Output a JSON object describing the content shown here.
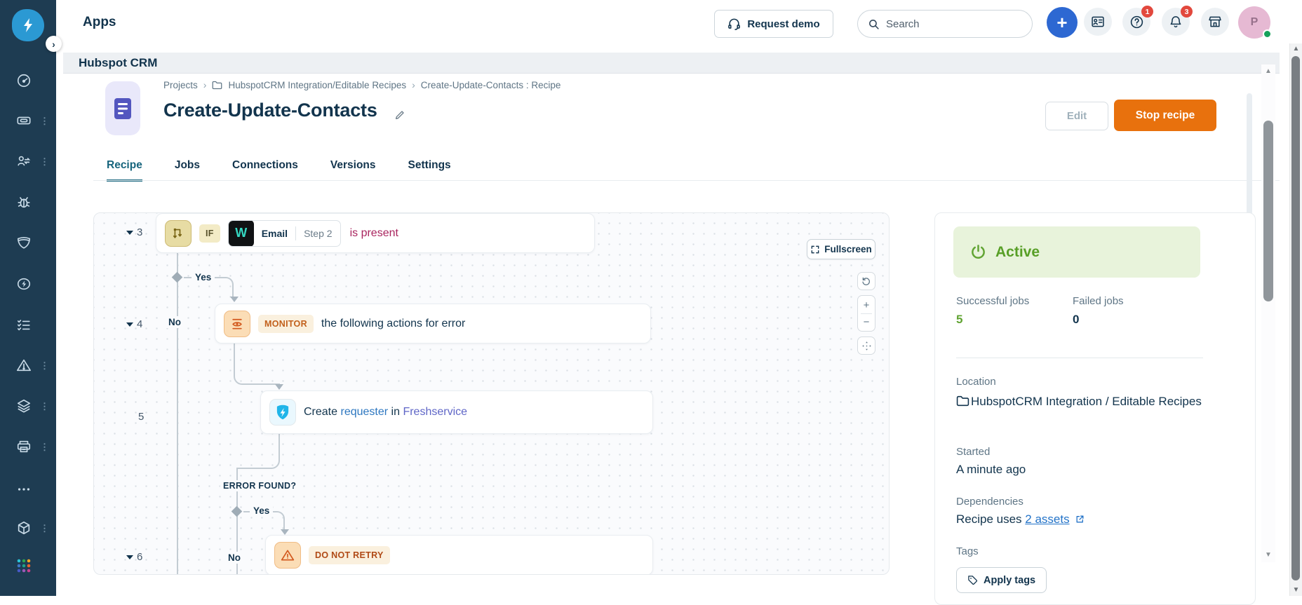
{
  "colors": {
    "sidebar_navy": "#1E3C52",
    "accent_orange": "#E8710D",
    "active_tab_teal": "#17657D",
    "status_green": "#61A433",
    "link_blue": "#2373C8",
    "condition_magenta": "#A9245E",
    "badge_red": "#E2483D"
  },
  "sidebar": {
    "icons": [
      "logo-bolt",
      "dashboard-gauge",
      "ticket",
      "contact-sync",
      "bug",
      "shield",
      "automation-bolt",
      "checklist",
      "alert-triangle",
      "layers",
      "printer",
      "more-ellipsis",
      "package-cube",
      "app-switcher-grid"
    ]
  },
  "topbar": {
    "title": "Apps",
    "request_demo_label": "Request demo",
    "search_placeholder": "Search",
    "help_badge": "1",
    "notifications_badge": "3",
    "avatar_initial": "P"
  },
  "subheader": {
    "app_name": "Hubspot CRM"
  },
  "breadcrumb": {
    "items": [
      {
        "label": "Projects"
      },
      {
        "label": "HubspotCRM Integration/Editable Recipes"
      },
      {
        "label": "Create-Update-Contacts : Recipe"
      }
    ]
  },
  "page": {
    "title": "Create-Update-Contacts",
    "edit_button": "Edit",
    "stop_button": "Stop recipe"
  },
  "tabs": {
    "items": [
      {
        "label": "Recipe"
      },
      {
        "label": "Jobs"
      },
      {
        "label": "Connections"
      },
      {
        "label": "Versions"
      },
      {
        "label": "Settings"
      }
    ]
  },
  "canvas": {
    "fullscreen_label": "Fullscreen",
    "zoom_in_label": "+",
    "zoom_out_label": "−",
    "steps": {
      "s3": {
        "number": "3",
        "chip": "IF",
        "pill_app": "W",
        "pill_field": "Email",
        "pill_step": "Step 2",
        "condition": "is present"
      },
      "s4": {
        "number": "4",
        "chip": "MONITOR",
        "text": "the following actions for error"
      },
      "s5": {
        "number": "5",
        "text_create": "Create",
        "link_object": "requester",
        "text_in": "in",
        "link_app": "Freshservice"
      },
      "s6": {
        "number": "6",
        "chip": "DO NOT RETRY"
      }
    },
    "labels": {
      "yes_top": "Yes",
      "no_top": "No",
      "error_found": "ERROR FOUND?",
      "yes_bottom": "Yes",
      "no_bottom": "No"
    }
  },
  "panel": {
    "status_label": "Active",
    "successful_jobs_label": "Successful jobs",
    "successful_jobs_value": "5",
    "failed_jobs_label": "Failed jobs",
    "failed_jobs_value": "0",
    "location_label": "Location",
    "location_value": "HubspotCRM Integration / Editable Recipes",
    "started_label": "Started",
    "started_value": "A minute ago",
    "dependencies_label": "Dependencies",
    "dependencies_prefix": "Recipe uses ",
    "dependencies_link": "2 assets",
    "tags_label": "Tags",
    "apply_tags_label": "Apply tags"
  }
}
